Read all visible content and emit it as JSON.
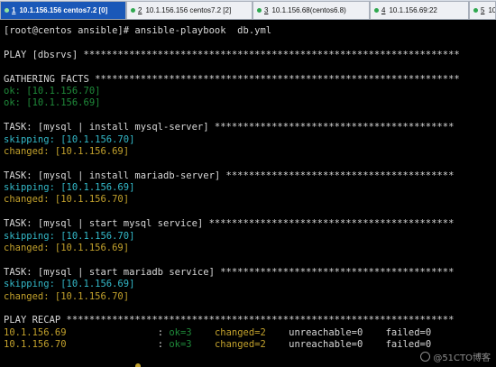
{
  "tabs": [
    {
      "num": "1",
      "label": "10.1.156.156 centos7.2 [0]",
      "active": true
    },
    {
      "num": "2",
      "label": "10.1.156.156 centos7.2 [2]",
      "active": false
    },
    {
      "num": "3",
      "label": "10.1.156.68(centos6.8)",
      "active": false
    },
    {
      "num": "4",
      "label": "10.1.156.69:22",
      "active": false
    },
    {
      "num": "5",
      "label": "10.1",
      "active": false
    }
  ],
  "terminal": {
    "lines": [
      {
        "segments": [
          {
            "text": "[root@centos ansible]# ansible-playbook  db.yml",
            "style": "plain"
          }
        ]
      },
      {
        "segments": [
          {
            "text": "",
            "style": "plain"
          }
        ]
      },
      {
        "segments": [
          {
            "text": "PLAY [dbsrvs] ******************************************************************",
            "style": "plain"
          }
        ]
      },
      {
        "segments": [
          {
            "text": "",
            "style": "plain"
          }
        ]
      },
      {
        "segments": [
          {
            "text": "GATHERING FACTS ****************************************************************",
            "style": "plain"
          }
        ]
      },
      {
        "segments": [
          {
            "text": "ok: [10.1.156.70]",
            "style": "ok"
          }
        ]
      },
      {
        "segments": [
          {
            "text": "ok: [10.1.156.69]",
            "style": "ok"
          }
        ]
      },
      {
        "segments": [
          {
            "text": "",
            "style": "plain"
          }
        ]
      },
      {
        "segments": [
          {
            "text": "TASK: [mysql | install mysql-server] ******************************************",
            "style": "plain"
          }
        ]
      },
      {
        "segments": [
          {
            "text": "skipping: [10.1.156.70]",
            "style": "skip"
          }
        ]
      },
      {
        "segments": [
          {
            "text": "changed: [10.1.156.69]",
            "style": "changed"
          }
        ]
      },
      {
        "segments": [
          {
            "text": "",
            "style": "plain"
          }
        ]
      },
      {
        "segments": [
          {
            "text": "TASK: [mysql | install mariadb-server] ****************************************",
            "style": "plain"
          }
        ]
      },
      {
        "segments": [
          {
            "text": "skipping: [10.1.156.69]",
            "style": "skip"
          }
        ]
      },
      {
        "segments": [
          {
            "text": "changed: [10.1.156.70]",
            "style": "changed"
          }
        ]
      },
      {
        "segments": [
          {
            "text": "",
            "style": "plain"
          }
        ]
      },
      {
        "segments": [
          {
            "text": "TASK: [mysql | start mysql service] *******************************************",
            "style": "plain"
          }
        ]
      },
      {
        "segments": [
          {
            "text": "skipping: [10.1.156.70]",
            "style": "skip"
          }
        ]
      },
      {
        "segments": [
          {
            "text": "changed: [10.1.156.69]",
            "style": "changed"
          }
        ]
      },
      {
        "segments": [
          {
            "text": "",
            "style": "plain"
          }
        ]
      },
      {
        "segments": [
          {
            "text": "TASK: [mysql | start mariadb service] *****************************************",
            "style": "plain"
          }
        ]
      },
      {
        "segments": [
          {
            "text": "skipping: [10.1.156.69]",
            "style": "skip"
          }
        ]
      },
      {
        "segments": [
          {
            "text": "changed: [10.1.156.70]",
            "style": "changed"
          }
        ]
      },
      {
        "segments": [
          {
            "text": "",
            "style": "plain"
          }
        ]
      },
      {
        "segments": [
          {
            "text": "PLAY RECAP ********************************************************************",
            "style": "plain"
          }
        ]
      },
      {
        "segments": [
          {
            "text": "10.1.156.69",
            "style": "changed"
          },
          {
            "text": "                : ",
            "style": "plain"
          },
          {
            "text": "ok=3",
            "style": "ok"
          },
          {
            "text": "    ",
            "style": "plain"
          },
          {
            "text": "changed=2",
            "style": "changed"
          },
          {
            "text": "    unreachable=0    failed=0",
            "style": "plain"
          }
        ]
      },
      {
        "segments": [
          {
            "text": "10.1.156.70",
            "style": "changed"
          },
          {
            "text": "                : ",
            "style": "plain"
          },
          {
            "text": "ok=3",
            "style": "ok"
          },
          {
            "text": "    ",
            "style": "plain"
          },
          {
            "text": "changed=2",
            "style": "changed"
          },
          {
            "text": "    unreachable=0    failed=0",
            "style": "plain"
          }
        ]
      }
    ]
  },
  "watermark": "@51CTO博客",
  "colors": {
    "ok": "#1f8a3a",
    "skipping": "#33b8c8",
    "changed": "#c2a12c",
    "active_tab": "#1a58b8",
    "terminal_bg": "#000000"
  }
}
